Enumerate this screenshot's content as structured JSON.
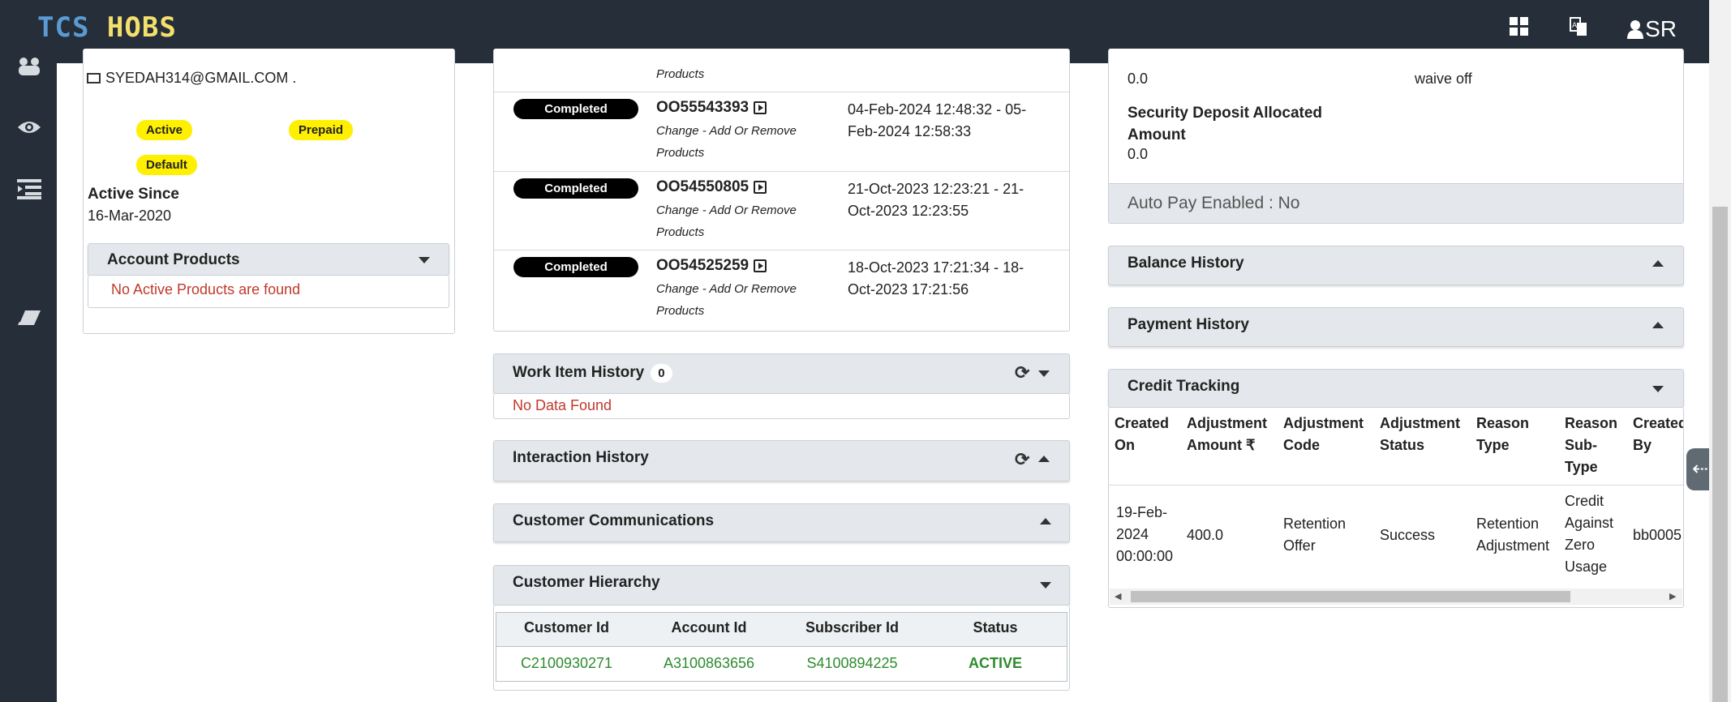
{
  "app": {
    "brand_part1": "TCS",
    "brand_part2": "HOBS",
    "user_initials": "SR"
  },
  "colors": {
    "topbar": "#252e39",
    "badge_yellow": "#ffef00",
    "pill_black": "#000000",
    "status_green": "#2e8b2e",
    "error_red": "#c0392b"
  },
  "left_card": {
    "email": "SYEDAH314@GMAIL.COM .",
    "badges": [
      "Active",
      "Prepaid",
      "Default"
    ],
    "active_since_label": "Active Since",
    "active_since_value": "16-Mar-2020",
    "products_title": "Account Products",
    "products_empty": "No Active Products are found"
  },
  "orders": {
    "top_partial_type": "Products",
    "rows": [
      {
        "status": "Completed",
        "id": "OO55543393",
        "type_l1": "Change - Add Or Remove",
        "type_l2": "Products",
        "date_l1": "04-Feb-2024 12:48:32 - 05-",
        "date_l2": "Feb-2024 12:58:33"
      },
      {
        "status": "Completed",
        "id": "OO54550805",
        "type_l1": "Change - Add Or Remove",
        "type_l2": "Products",
        "date_l1": "21-Oct-2023 12:23:21 - 21-",
        "date_l2": "Oct-2023 12:23:55"
      },
      {
        "status": "Completed",
        "id": "OO54525259",
        "type_l1": "Change - Add Or Remove",
        "type_l2": "Products",
        "date_l1": "18-Oct-2023 17:21:34 - 18-",
        "date_l2": "Oct-2023 17:21:56"
      }
    ]
  },
  "work_item": {
    "title": "Work Item History",
    "count": "0",
    "empty": "No Data Found"
  },
  "interaction": {
    "title": "Interaction History"
  },
  "communications": {
    "title": "Customer Communications"
  },
  "hierarchy": {
    "title": "Customer Hierarchy",
    "headers": [
      "Customer Id",
      "Account Id",
      "Subscriber Id",
      "Status"
    ],
    "row": [
      "C2100930271",
      "A3100863656",
      "S4100894225",
      "ACTIVE"
    ]
  },
  "billing": {
    "val_left": "0.0",
    "val_right": "waive off",
    "sd_label_l1": "Security Deposit Allocated",
    "sd_label_l2": "Amount",
    "sd_value": "0.0",
    "autopay": "Auto Pay Enabled : No"
  },
  "balance": {
    "title": "Balance History"
  },
  "payment": {
    "title": "Payment History"
  },
  "credit": {
    "title": "Credit Tracking",
    "headers": [
      [
        "Created",
        "On"
      ],
      [
        "Adjustment",
        "Amount ₹"
      ],
      [
        "Adjustment",
        "Code"
      ],
      [
        "Adjustment",
        "Status"
      ],
      [
        "Reason",
        "Type"
      ],
      [
        "Reason",
        "Sub-",
        "Type"
      ],
      [
        "Created",
        "By"
      ]
    ],
    "row": [
      [
        "19-Feb-",
        "2024",
        "00:00:00"
      ],
      [
        "400.0"
      ],
      [
        "Retention",
        "Offer"
      ],
      [
        "Success"
      ],
      [
        "Retention",
        "Adjustment"
      ],
      [
        "Credit",
        "Against",
        "Zero",
        "Usage"
      ],
      [
        "bb0005"
      ]
    ]
  },
  "icons": [
    "users-icon",
    "eye-icon",
    "list-icon",
    "eraser-icon",
    "dashboard-grid-icon",
    "translate-icon",
    "user-icon",
    "refresh-icon",
    "play-icon",
    "envelope-icon",
    "arrow-left-icon"
  ]
}
